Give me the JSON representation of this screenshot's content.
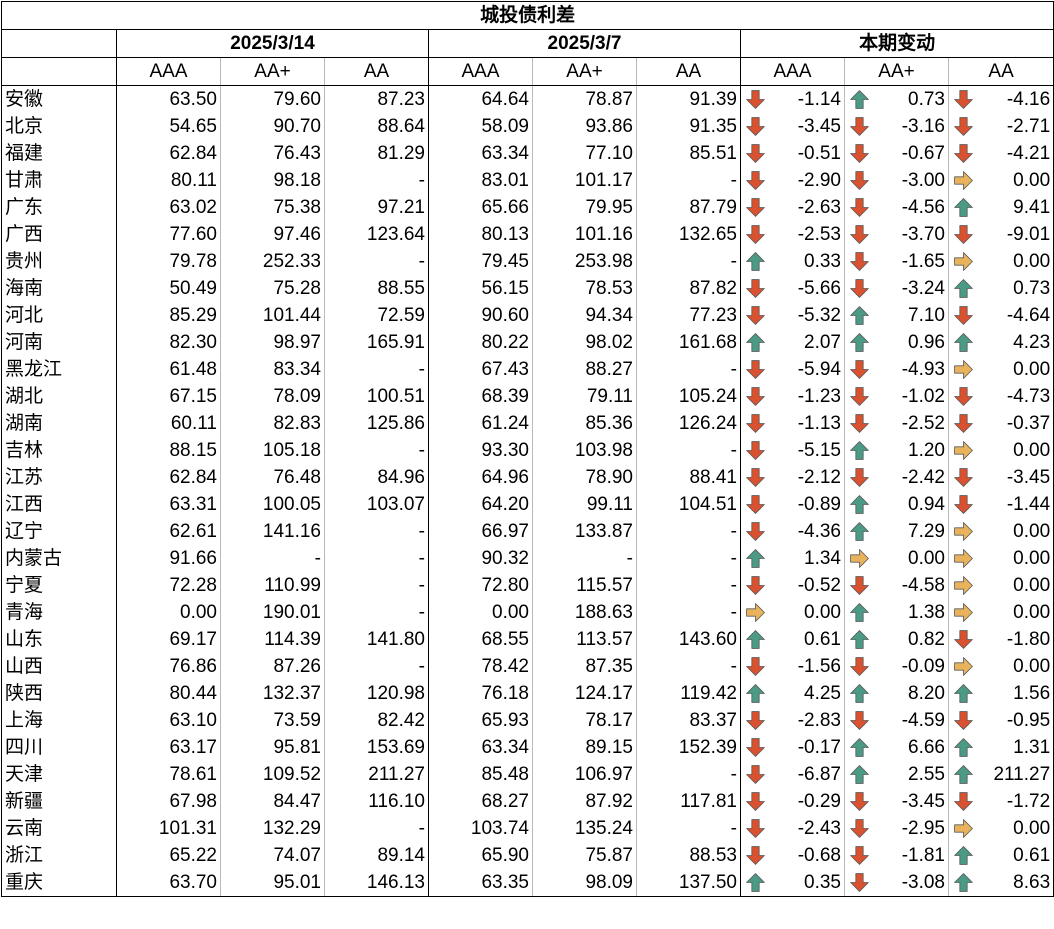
{
  "title": "城投债利差",
  "groups": [
    "2025/3/14",
    "2025/3/7",
    "本期变动"
  ],
  "ratings": [
    "AAA",
    "AA+",
    "AA"
  ],
  "colors": {
    "down": "#d9512e",
    "up": "#4a9a86",
    "flat": "#e9b35c"
  },
  "icons": {
    "down": "arrow-down-icon",
    "up": "arrow-up-icon",
    "flat": "arrow-right-icon"
  },
  "rows": [
    {
      "province": "安徽",
      "c": [
        "63.50",
        "79.60",
        "87.23"
      ],
      "p": [
        "64.64",
        "78.87",
        "91.39"
      ],
      "d": [
        "-1.14",
        "0.73",
        "-4.16"
      ],
      "dir": [
        "down",
        "up",
        "down"
      ]
    },
    {
      "province": "北京",
      "c": [
        "54.65",
        "90.70",
        "88.64"
      ],
      "p": [
        "58.09",
        "93.86",
        "91.35"
      ],
      "d": [
        "-3.45",
        "-3.16",
        "-2.71"
      ],
      "dir": [
        "down",
        "down",
        "down"
      ]
    },
    {
      "province": "福建",
      "c": [
        "62.84",
        "76.43",
        "81.29"
      ],
      "p": [
        "63.34",
        "77.10",
        "85.51"
      ],
      "d": [
        "-0.51",
        "-0.67",
        "-4.21"
      ],
      "dir": [
        "down",
        "down",
        "down"
      ]
    },
    {
      "province": "甘肃",
      "c": [
        "80.11",
        "98.18",
        "-"
      ],
      "p": [
        "83.01",
        "101.17",
        "-"
      ],
      "d": [
        "-2.90",
        "-3.00",
        "0.00"
      ],
      "dir": [
        "down",
        "down",
        "flat"
      ]
    },
    {
      "province": "广东",
      "c": [
        "63.02",
        "75.38",
        "97.21"
      ],
      "p": [
        "65.66",
        "79.95",
        "87.79"
      ],
      "d": [
        "-2.63",
        "-4.56",
        "9.41"
      ],
      "dir": [
        "down",
        "down",
        "up"
      ]
    },
    {
      "province": "广西",
      "c": [
        "77.60",
        "97.46",
        "123.64"
      ],
      "p": [
        "80.13",
        "101.16",
        "132.65"
      ],
      "d": [
        "-2.53",
        "-3.70",
        "-9.01"
      ],
      "dir": [
        "down",
        "down",
        "down"
      ]
    },
    {
      "province": "贵州",
      "c": [
        "79.78",
        "252.33",
        "-"
      ],
      "p": [
        "79.45",
        "253.98",
        "-"
      ],
      "d": [
        "0.33",
        "-1.65",
        "0.00"
      ],
      "dir": [
        "up",
        "down",
        "flat"
      ]
    },
    {
      "province": "海南",
      "c": [
        "50.49",
        "75.28",
        "88.55"
      ],
      "p": [
        "56.15",
        "78.53",
        "87.82"
      ],
      "d": [
        "-5.66",
        "-3.24",
        "0.73"
      ],
      "dir": [
        "down",
        "down",
        "up"
      ]
    },
    {
      "province": "河北",
      "c": [
        "85.29",
        "101.44",
        "72.59"
      ],
      "p": [
        "90.60",
        "94.34",
        "77.23"
      ],
      "d": [
        "-5.32",
        "7.10",
        "-4.64"
      ],
      "dir": [
        "down",
        "up",
        "down"
      ]
    },
    {
      "province": "河南",
      "c": [
        "82.30",
        "98.97",
        "165.91"
      ],
      "p": [
        "80.22",
        "98.02",
        "161.68"
      ],
      "d": [
        "2.07",
        "0.96",
        "4.23"
      ],
      "dir": [
        "up",
        "up",
        "up"
      ]
    },
    {
      "province": "黑龙江",
      "c": [
        "61.48",
        "83.34",
        "-"
      ],
      "p": [
        "67.43",
        "88.27",
        "-"
      ],
      "d": [
        "-5.94",
        "-4.93",
        "0.00"
      ],
      "dir": [
        "down",
        "down",
        "flat"
      ]
    },
    {
      "province": "湖北",
      "c": [
        "67.15",
        "78.09",
        "100.51"
      ],
      "p": [
        "68.39",
        "79.11",
        "105.24"
      ],
      "d": [
        "-1.23",
        "-1.02",
        "-4.73"
      ],
      "dir": [
        "down",
        "down",
        "down"
      ]
    },
    {
      "province": "湖南",
      "c": [
        "60.11",
        "82.83",
        "125.86"
      ],
      "p": [
        "61.24",
        "85.36",
        "126.24"
      ],
      "d": [
        "-1.13",
        "-2.52",
        "-0.37"
      ],
      "dir": [
        "down",
        "down",
        "down"
      ]
    },
    {
      "province": "吉林",
      "c": [
        "88.15",
        "105.18",
        "-"
      ],
      "p": [
        "93.30",
        "103.98",
        "-"
      ],
      "d": [
        "-5.15",
        "1.20",
        "0.00"
      ],
      "dir": [
        "down",
        "up",
        "flat"
      ]
    },
    {
      "province": "江苏",
      "c": [
        "62.84",
        "76.48",
        "84.96"
      ],
      "p": [
        "64.96",
        "78.90",
        "88.41"
      ],
      "d": [
        "-2.12",
        "-2.42",
        "-3.45"
      ],
      "dir": [
        "down",
        "down",
        "down"
      ]
    },
    {
      "province": "江西",
      "c": [
        "63.31",
        "100.05",
        "103.07"
      ],
      "p": [
        "64.20",
        "99.11",
        "104.51"
      ],
      "d": [
        "-0.89",
        "0.94",
        "-1.44"
      ],
      "dir": [
        "down",
        "up",
        "down"
      ]
    },
    {
      "province": "辽宁",
      "c": [
        "62.61",
        "141.16",
        "-"
      ],
      "p": [
        "66.97",
        "133.87",
        "-"
      ],
      "d": [
        "-4.36",
        "7.29",
        "0.00"
      ],
      "dir": [
        "down",
        "up",
        "flat"
      ]
    },
    {
      "province": "内蒙古",
      "c": [
        "91.66",
        "-",
        "-"
      ],
      "p": [
        "90.32",
        "-",
        "-"
      ],
      "d": [
        "1.34",
        "0.00",
        "0.00"
      ],
      "dir": [
        "up",
        "flat",
        "flat"
      ]
    },
    {
      "province": "宁夏",
      "c": [
        "72.28",
        "110.99",
        "-"
      ],
      "p": [
        "72.80",
        "115.57",
        "-"
      ],
      "d": [
        "-0.52",
        "-4.58",
        "0.00"
      ],
      "dir": [
        "down",
        "down",
        "flat"
      ]
    },
    {
      "province": "青海",
      "c": [
        "0.00",
        "190.01",
        "-"
      ],
      "p": [
        "0.00",
        "188.63",
        "-"
      ],
      "d": [
        "0.00",
        "1.38",
        "0.00"
      ],
      "dir": [
        "flat",
        "up",
        "flat"
      ]
    },
    {
      "province": "山东",
      "c": [
        "69.17",
        "114.39",
        "141.80"
      ],
      "p": [
        "68.55",
        "113.57",
        "143.60"
      ],
      "d": [
        "0.61",
        "0.82",
        "-1.80"
      ],
      "dir": [
        "up",
        "up",
        "down"
      ]
    },
    {
      "province": "山西",
      "c": [
        "76.86",
        "87.26",
        "-"
      ],
      "p": [
        "78.42",
        "87.35",
        "-"
      ],
      "d": [
        "-1.56",
        "-0.09",
        "0.00"
      ],
      "dir": [
        "down",
        "down",
        "flat"
      ]
    },
    {
      "province": "陕西",
      "c": [
        "80.44",
        "132.37",
        "120.98"
      ],
      "p": [
        "76.18",
        "124.17",
        "119.42"
      ],
      "d": [
        "4.25",
        "8.20",
        "1.56"
      ],
      "dir": [
        "up",
        "up",
        "up"
      ]
    },
    {
      "province": "上海",
      "c": [
        "63.10",
        "73.59",
        "82.42"
      ],
      "p": [
        "65.93",
        "78.17",
        "83.37"
      ],
      "d": [
        "-2.83",
        "-4.59",
        "-0.95"
      ],
      "dir": [
        "down",
        "down",
        "down"
      ]
    },
    {
      "province": "四川",
      "c": [
        "63.17",
        "95.81",
        "153.69"
      ],
      "p": [
        "63.34",
        "89.15",
        "152.39"
      ],
      "d": [
        "-0.17",
        "6.66",
        "1.31"
      ],
      "dir": [
        "down",
        "up",
        "up"
      ]
    },
    {
      "province": "天津",
      "c": [
        "78.61",
        "109.52",
        "211.27"
      ],
      "p": [
        "85.48",
        "106.97",
        "-"
      ],
      "d": [
        "-6.87",
        "2.55",
        "211.27"
      ],
      "dir": [
        "down",
        "up",
        "up"
      ]
    },
    {
      "province": "新疆",
      "c": [
        "67.98",
        "84.47",
        "116.10"
      ],
      "p": [
        "68.27",
        "87.92",
        "117.81"
      ],
      "d": [
        "-0.29",
        "-3.45",
        "-1.72"
      ],
      "dir": [
        "down",
        "down",
        "down"
      ]
    },
    {
      "province": "云南",
      "c": [
        "101.31",
        "132.29",
        "-"
      ],
      "p": [
        "103.74",
        "135.24",
        "-"
      ],
      "d": [
        "-2.43",
        "-2.95",
        "0.00"
      ],
      "dir": [
        "down",
        "down",
        "flat"
      ]
    },
    {
      "province": "浙江",
      "c": [
        "65.22",
        "74.07",
        "89.14"
      ],
      "p": [
        "65.90",
        "75.87",
        "88.53"
      ],
      "d": [
        "-0.68",
        "-1.81",
        "0.61"
      ],
      "dir": [
        "down",
        "down",
        "up"
      ]
    },
    {
      "province": "重庆",
      "c": [
        "63.70",
        "95.01",
        "146.13"
      ],
      "p": [
        "63.35",
        "98.09",
        "137.50"
      ],
      "d": [
        "0.35",
        "-3.08",
        "8.63"
      ],
      "dir": [
        "up",
        "down",
        "up"
      ]
    }
  ]
}
